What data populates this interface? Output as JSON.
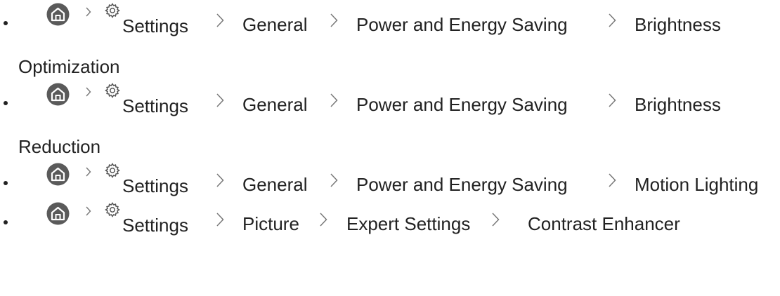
{
  "colors": {
    "text": "#222222",
    "home_icon_fill": "#5a5a5a",
    "separator": "#777777"
  },
  "icons": {
    "home": "home-icon",
    "settings": "gear-icon",
    "separator": "chevron-right-icon"
  },
  "items": [
    {
      "crumbs": [
        "Settings",
        "General",
        "Power and Energy Saving",
        "Brightness"
      ],
      "continuation": "Optimization"
    },
    {
      "crumbs": [
        "Settings",
        "General",
        "Power and Energy Saving",
        "Brightness"
      ],
      "continuation": "Reduction"
    },
    {
      "crumbs": [
        "Settings",
        "General",
        "Power and Energy Saving",
        "Motion Lighting"
      ]
    },
    {
      "crumbs": [
        "Settings",
        "Picture",
        "Expert Settings",
        "Contrast Enhancer"
      ]
    }
  ]
}
